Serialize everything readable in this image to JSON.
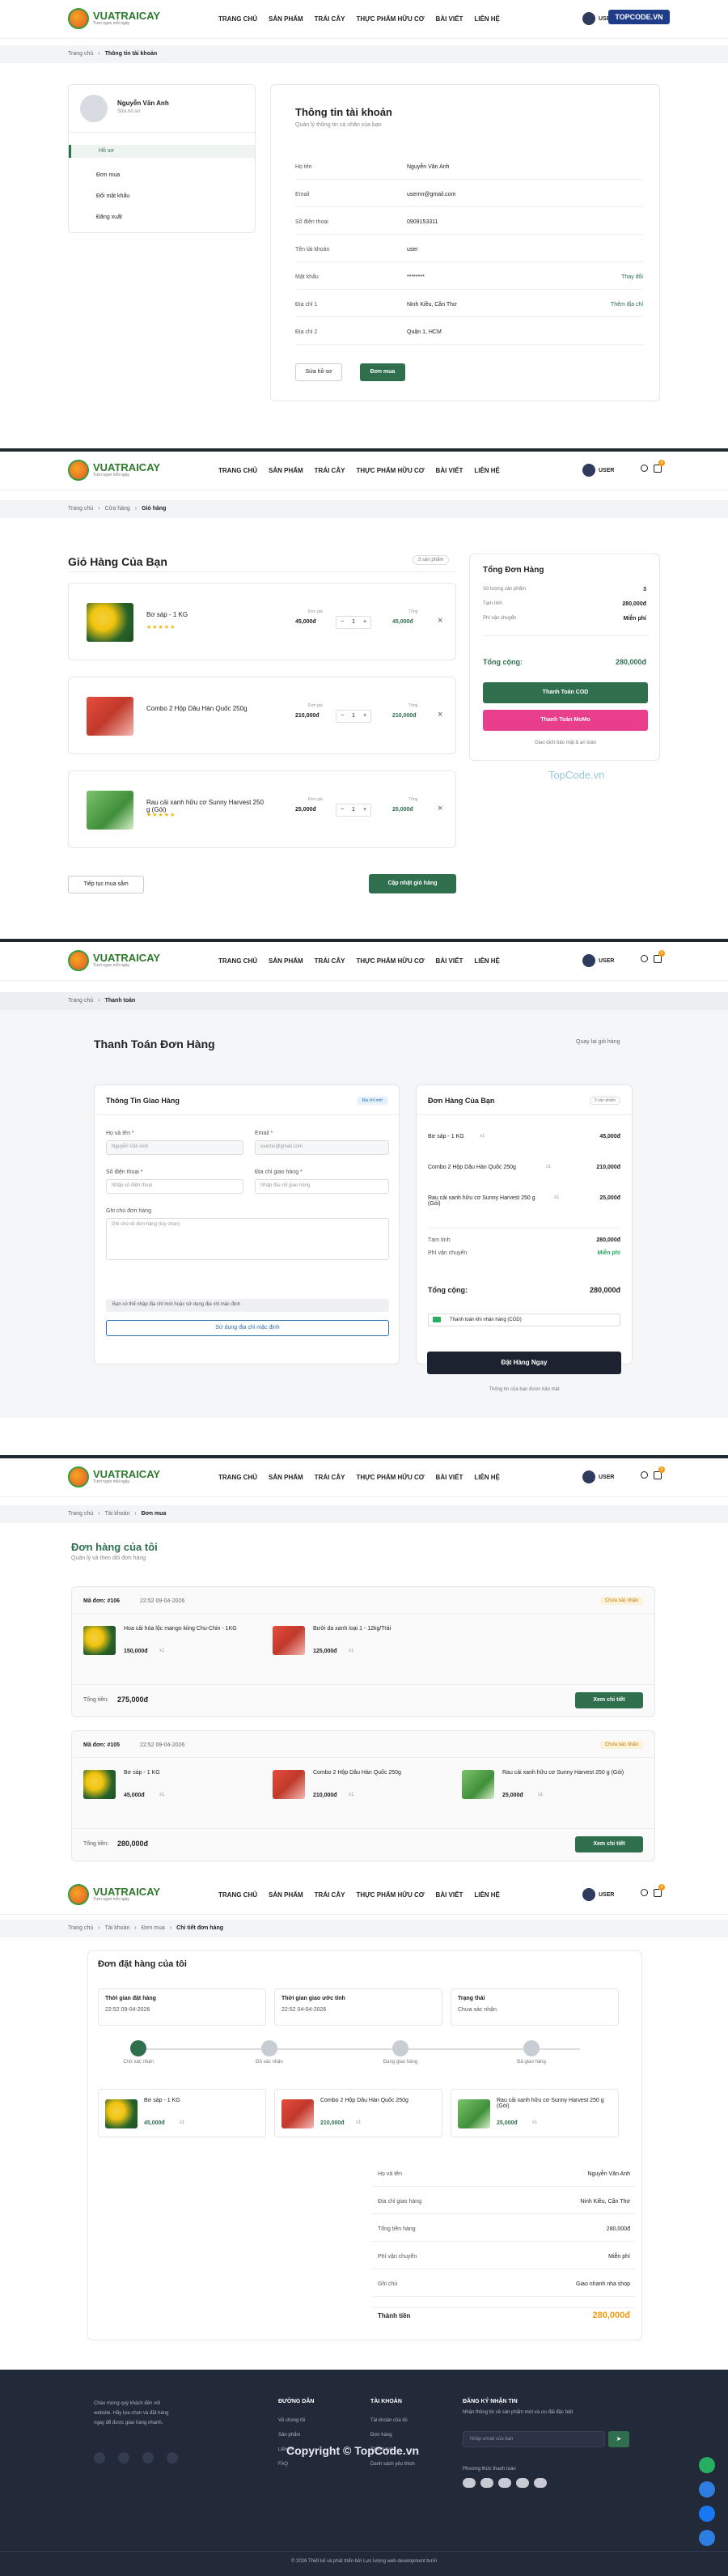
{
  "brand": {
    "name": "VUATRAICAY",
    "tagline": "Tươi ngon mỗi ngày"
  },
  "nav": [
    "TRANG CHỦ",
    "SẢN PHẨM",
    "TRÁI CÂY",
    "THỰC PHẨM HỮU CƠ",
    "BÀI VIẾT",
    "LIÊN HỆ"
  ],
  "user": "USER",
  "cart_count": "0",
  "s1": {
    "crumb": [
      "Trang chủ",
      "Thông tin tài khoản"
    ],
    "name": "Nguyễn Văn Anh",
    "role": "Sửa hồ sơ",
    "menu": [
      "Hồ sơ",
      "Đơn mua",
      "Đổi mật khẩu",
      "Đăng xuất"
    ],
    "title": "Thông tin tài khoản",
    "subtitle": "Quản lý thông tin cá nhân của bạn",
    "rows": [
      [
        "Họ tên",
        "Nguyễn Văn Anh",
        ""
      ],
      [
        "Email",
        "usernn@gmail.com",
        ""
      ],
      [
        "Số điện thoại",
        "0909153311",
        ""
      ],
      [
        "Tên tài khoản",
        "user",
        ""
      ],
      [
        "Mật khẩu",
        "********",
        "Thay đổi"
      ],
      [
        "Địa chỉ 1",
        "Ninh Kiều, Cần Thơ",
        "Thêm địa chỉ"
      ],
      [
        "Địa chỉ 2",
        "Quận 1, HCM",
        ""
      ]
    ],
    "btn_edit": "Sửa hồ sơ",
    "btn_orders": "Đơn mua"
  },
  "s2": {
    "crumb": [
      "Trang chủ",
      "Cửa hàng",
      "Giỏ hàng"
    ],
    "title": "Giỏ Hàng Của Bạn",
    "count": "3 sản phẩm",
    "items": [
      {
        "name": "Bơ sáp - 1 KG",
        "unit_label": "Đơn giá",
        "price": "45,000đ",
        "qty": "1",
        "total_label": "Tổng",
        "total": "45,000đ",
        "stars": "★★★★★"
      },
      {
        "name": "Combo 2 Hộp Dâu Hàn Quốc 250g",
        "unit_label": "Đơn giá",
        "price": "210,000đ",
        "qty": "1",
        "total_label": "Tổng",
        "total": "210,000đ",
        "stars": ""
      },
      {
        "name": "Rau cải xanh hữu cơ Sunny Harvest 250 g (Gói)",
        "unit_label": "Đơn giá",
        "price": "25,000đ",
        "qty": "1",
        "total_label": "Tổng",
        "total": "25,000đ",
        "stars": "★★★★★"
      }
    ],
    "back": "Tiếp tục mua sắm",
    "update": "Cập nhật giỏ hàng",
    "summary_title": "Tổng Đơn Hàng",
    "sum_rows": [
      [
        "Số lượng sản phẩm",
        "3"
      ],
      [
        "Tạm tính",
        "280,000đ"
      ],
      [
        "Phí vận chuyển",
        "Miễn phí"
      ]
    ],
    "total_label": "Tổng cộng:",
    "total": "280,000đ",
    "cod": "Thanh Toán COD",
    "momo": "Thanh Toán MoMo",
    "secure": "Giao dịch bảo mật & an toàn"
  },
  "s3": {
    "crumb": [
      "Trang chủ",
      "Thanh toán"
    ],
    "title": "Thanh Toán Đơn Hàng",
    "back": "Quay lại giỏ hàng",
    "ship_title": "Thông Tin Giao Hàng",
    "ship_badge": "Địa chỉ mới",
    "f_name": "Họ và tên *",
    "f_name_v": "Nguyễn Văn Anh",
    "f_email": "Email *",
    "f_email_v": "usernn@gmail.com",
    "f_phone": "Số điện thoại *",
    "f_phone_p": "Nhập số điện thoại",
    "f_addr": "Địa chỉ giao hàng *",
    "f_addr_p": "Nhập địa chỉ giao hàng",
    "f_note": "Ghi chú đơn hàng",
    "f_note_p": "Ghi chú về đơn hàng (tùy chọn)",
    "info": "Bạn có thể nhập địa chỉ mới hoặc sử dụng địa chỉ mặc định",
    "use_default": "Sử dụng địa chỉ mặc định",
    "order_title": "Đơn Hàng Của Bạn",
    "order_count": "3 sản phẩm",
    "lines": [
      [
        "Bơ sáp - 1 KG",
        "x1",
        "45,000đ"
      ],
      [
        "Combo 2 Hộp Dâu Hàn Quốc 250g",
        "x1",
        "210,000đ"
      ],
      [
        "Rau cải xanh hữu cơ Sunny Harvest 250 g (Gói)",
        "x1",
        "25,000đ"
      ]
    ],
    "sub_label": "Tạm tính",
    "sub": "280,000đ",
    "ship_label": "Phí vận chuyển",
    "ship": "Miễn phí",
    "total_label": "Tổng cộng:",
    "total": "280,000đ",
    "cod": "Thanh toán khi nhận hàng (COD)",
    "place": "Đặt Hàng Ngay",
    "note": "Thông tin của bạn được bảo mật"
  },
  "s4": {
    "crumb": [
      "Trang chủ",
      "Tài khoản",
      "Đơn mua"
    ],
    "title": "Đơn hàng của tôi",
    "subtitle": "Quản lý và theo dõi đơn hàng",
    "orders": [
      {
        "id": "Mã đơn: #106",
        "date": "22:52 09-04-2026",
        "status": "Chưa xác nhận",
        "items": [
          [
            "Hoa cải hóa lộc mango kiing Chu-Chin - 1KG",
            "150,000đ",
            "x1"
          ],
          [
            "Bưởi da xanh loại 1 - 12kg/Trái",
            "125,000đ",
            "x1"
          ]
        ],
        "total_label": "Tổng tiền:",
        "total": "275,000đ",
        "btn": "Xem chi tiết"
      },
      {
        "id": "Mã đơn: #105",
        "date": "22:52 09-04-2026",
        "status": "Chưa xác nhận",
        "items": [
          [
            "Bơ sáp - 1 KG",
            "45,000đ",
            "x1"
          ],
          [
            "Combo 2 Hộp Dâu Hàn Quốc 250g",
            "210,000đ",
            "x1"
          ],
          [
            "Rau cải xanh hữu cơ Sunny Harvest 250 g (Gói)",
            "25,000đ",
            "x1"
          ]
        ],
        "total_label": "Tổng tiền:",
        "total": "280,000đ",
        "btn": "Xem chi tiết"
      }
    ]
  },
  "s5": {
    "crumb": [
      "Trang chủ",
      "Tài khoản",
      "Đơn mua",
      "Chi tiết đơn hàng"
    ],
    "title": "Đơn đặt hàng của tôi",
    "meta": [
      [
        "Thời gian đặt hàng",
        "22:52 09-04-2026"
      ],
      [
        "Thời gian giao ước tính",
        "22:52 04-04-2026"
      ],
      [
        "Trạng thái",
        "Chưa xác nhận"
      ]
    ],
    "steps": [
      "Chờ xác nhận",
      "Đã xác nhận",
      "Đang giao hàng",
      "Đã giao hàng"
    ],
    "items": [
      [
        "Bơ sáp - 1 KG",
        "45,000đ",
        "x1"
      ],
      [
        "Combo 2 Hộp Dâu Hàn Quốc 250g",
        "210,000đ",
        "x1"
      ],
      [
        "Rau cải xanh hữu cơ Sunny Harvest 250 g (Gói)",
        "25,000đ",
        "x1"
      ]
    ],
    "rows": [
      [
        "Họ và tên",
        "Nguyễn Văn Anh"
      ],
      [
        "Địa chỉ giao hàng",
        "Ninh Kiều, Cần Thơ"
      ],
      [
        "Tổng tiền hàng",
        "280,000đ"
      ],
      [
        "Phí vận chuyển",
        "Miễn phí"
      ],
      [
        "Ghi chú",
        "Giao nhanh nha shop"
      ]
    ],
    "total_label": "Thành tiền",
    "total": "280,000đ"
  },
  "footer": {
    "about": "Chào mừng quý khách đến với website. Hãy lựa chọn và đặt hàng ngay để được giao hàng nhanh.",
    "col1_title": "ĐƯỜNG DẪN",
    "col1": [
      "Về chúng tôi",
      "Sản phẩm",
      "Liên hệ",
      "FAQ"
    ],
    "col2_title": "TÀI KHOẢN",
    "col2": [
      "Tài khoản của tôi",
      "Đơn hàng",
      "Thanh toán",
      "Danh sách yêu thích"
    ],
    "col3_title": "ĐĂNG KÝ NHẬN TIN",
    "col3_text": "Nhận thông tin về sản phẩm mới và ưu đãi đặc biệt",
    "email_p": "Nhập email của bạn",
    "pay_title": "Phương thức thanh toán",
    "copy": "© 2026 Thiết kế và phát triển bởi Lực lượng web development bưởi"
  },
  "watermark": [
    "TOPCODE.VN",
    "TopCode.vn",
    "Copyright © TopCode.vn"
  ],
  "colors": {
    "green": "#2f6f4e",
    "pink": "#e83e8c",
    "dark": "#222a3a",
    "orange": "#f39c12"
  }
}
